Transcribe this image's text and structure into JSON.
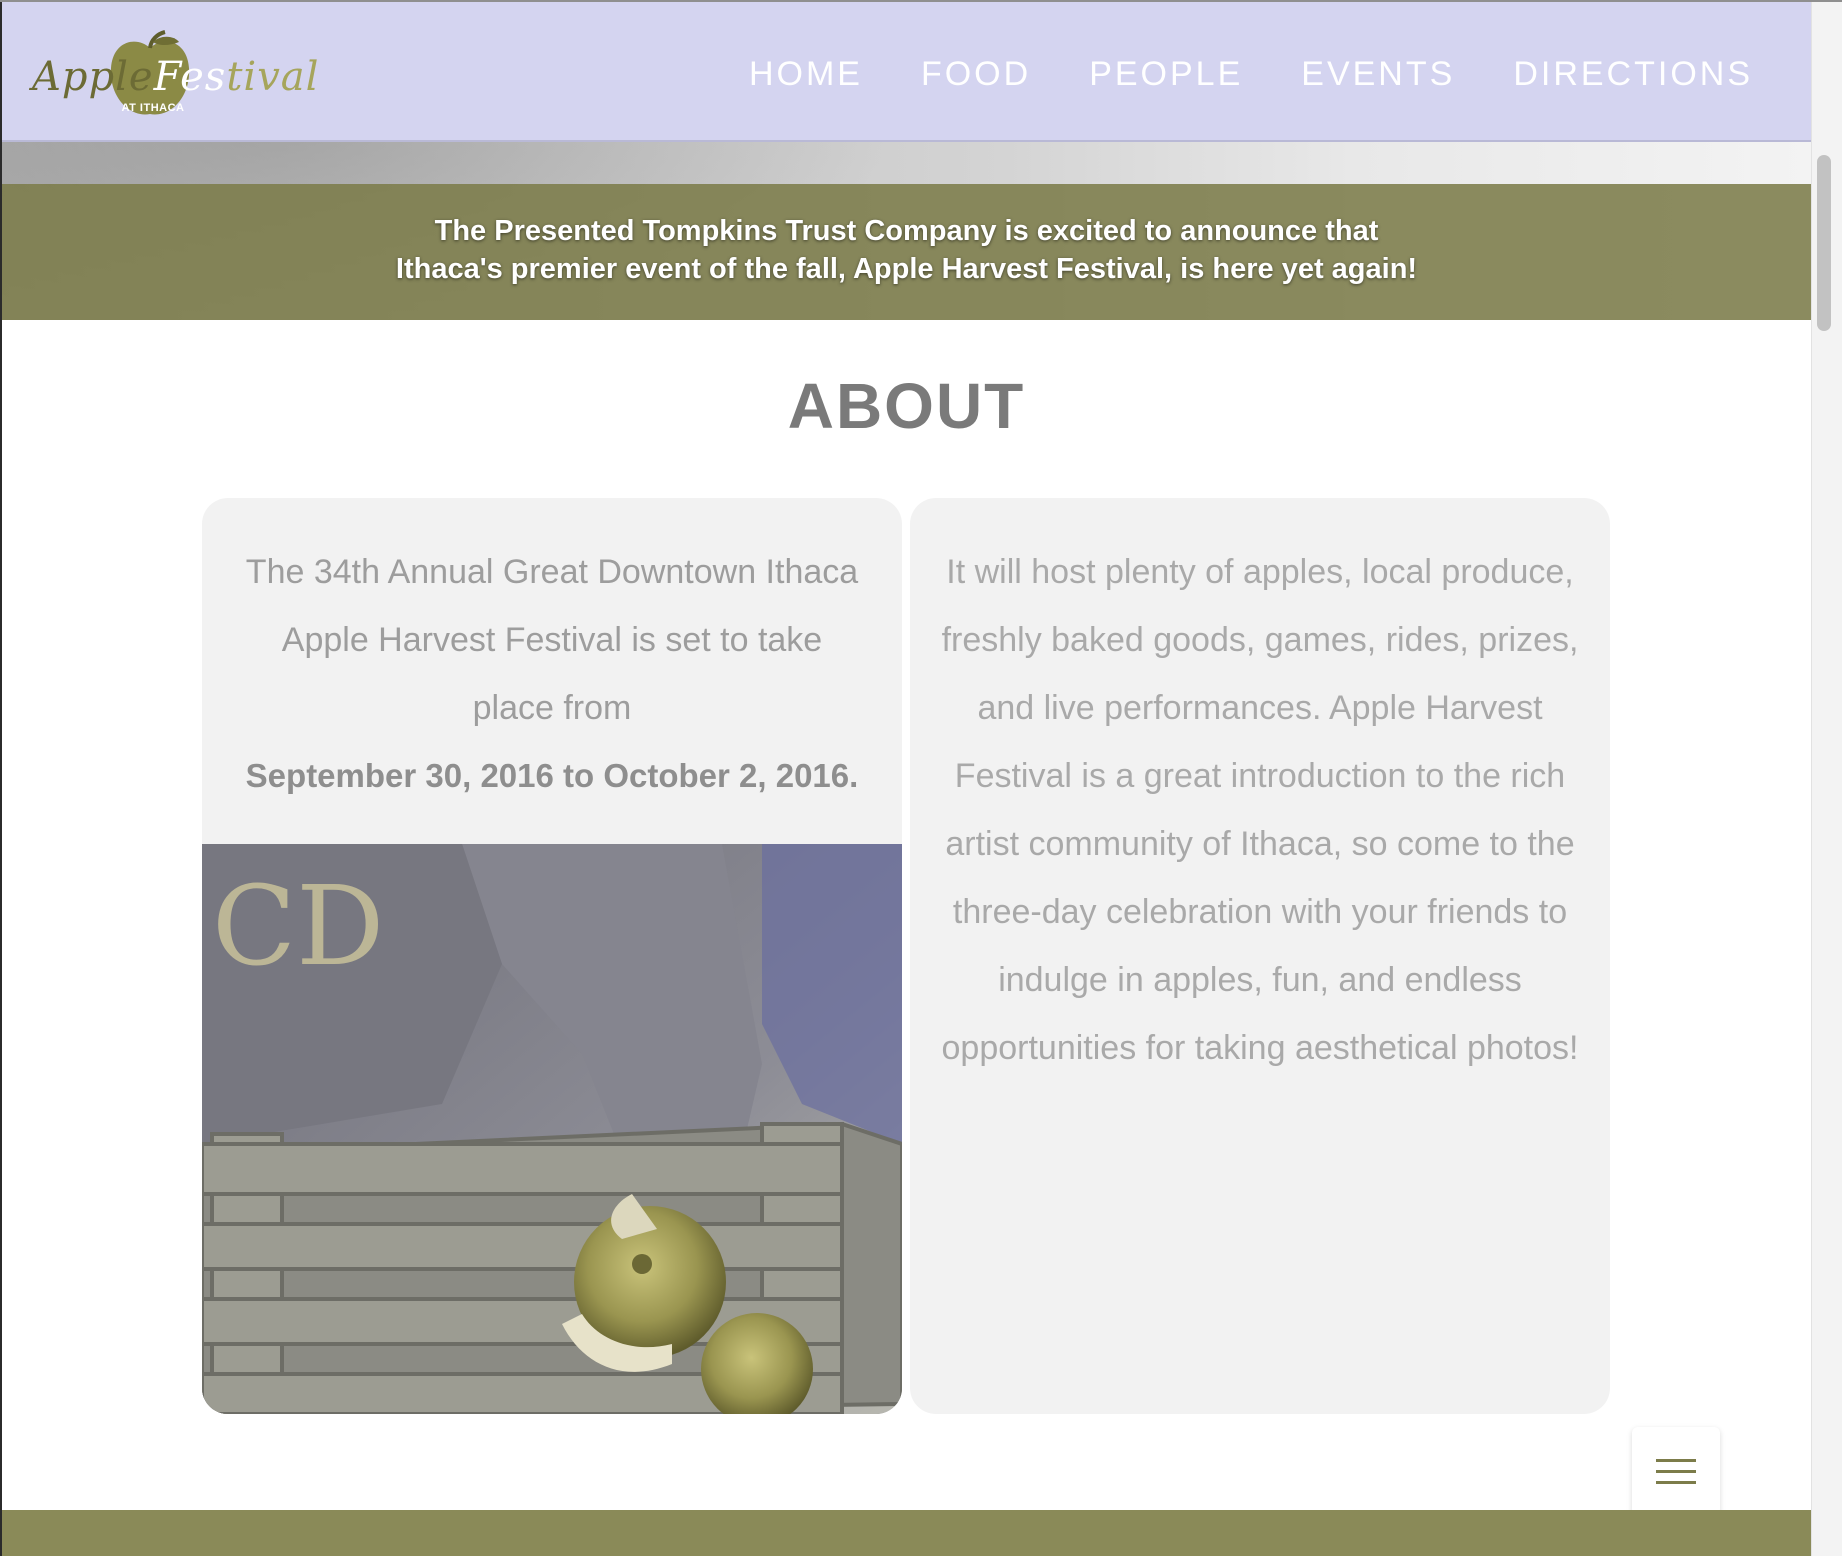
{
  "logo": {
    "word_apple": "Apple",
    "word_fes": "Fes",
    "word_tival": "tival",
    "subtitle": "AT ITHACA"
  },
  "nav": {
    "items": [
      "HOME",
      "FOOD",
      "PEOPLE",
      "EVENTS",
      "DIRECTIONS"
    ]
  },
  "banner": {
    "line1": "The Presented Tompkins Trust Company is excited to announce that",
    "line2": "Ithaca's premier event of the fall, Apple Harvest Festival, is here yet again!"
  },
  "about": {
    "title": "ABOUT",
    "left_text": "The 34th Annual Great Downtown Ithaca Apple Harvest Festival is set to take place from",
    "left_dates": "September 30, 2016 to October 2, 2016.",
    "right_text": "It will host plenty of apples, local produce, freshly baked goods, games, rides, prizes, and live performances. Apple Harvest Festival is a great introduction to the rich artist community of Ithaca, so come to the three-day celebration with your friends to indulge in apples, fun, and endless opportunities for taking aesthetical photos!"
  },
  "colors": {
    "nav_bg": "#d4d4f0",
    "olive": "#7c7c4a",
    "card_bg": "#f2f2f2"
  },
  "icons": {
    "menu": "hamburger-icon",
    "logo_apple": "apple-icon"
  }
}
